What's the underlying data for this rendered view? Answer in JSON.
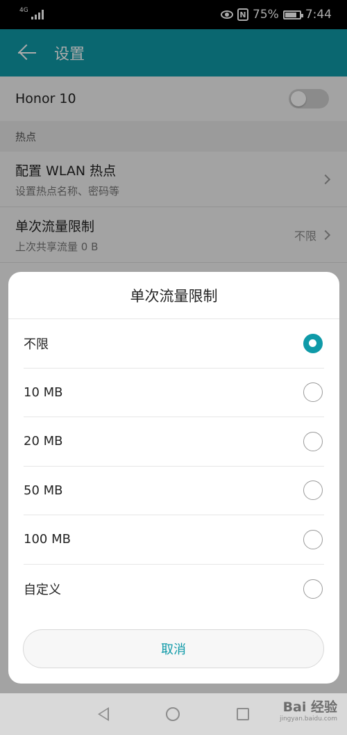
{
  "status_bar": {
    "network": "4G",
    "battery": "75%",
    "time": "7:44"
  },
  "app_bar": {
    "title": "设置"
  },
  "hotspot_row": {
    "label": "Honor 10",
    "enabled": false
  },
  "section": {
    "header": "热点"
  },
  "rows": [
    {
      "title": "配置 WLAN 热点",
      "subtitle": "设置热点名称、密码等",
      "value": ""
    },
    {
      "title": "单次流量限制",
      "subtitle": "上次共享流量 0 B",
      "value": "不限"
    }
  ],
  "dialog": {
    "title": "单次流量限制",
    "options": [
      {
        "label": "不限",
        "selected": true
      },
      {
        "label": "10 MB",
        "selected": false
      },
      {
        "label": "20 MB",
        "selected": false
      },
      {
        "label": "50 MB",
        "selected": false
      },
      {
        "label": "100 MB",
        "selected": false
      },
      {
        "label": "自定义",
        "selected": false
      }
    ],
    "cancel_label": "取消"
  },
  "watermark": {
    "text": "Bai 经验",
    "url_text": "jingyan.baidu.com"
  },
  "colors": {
    "accent": "#0f9aa8",
    "status_bar": "#000000"
  }
}
